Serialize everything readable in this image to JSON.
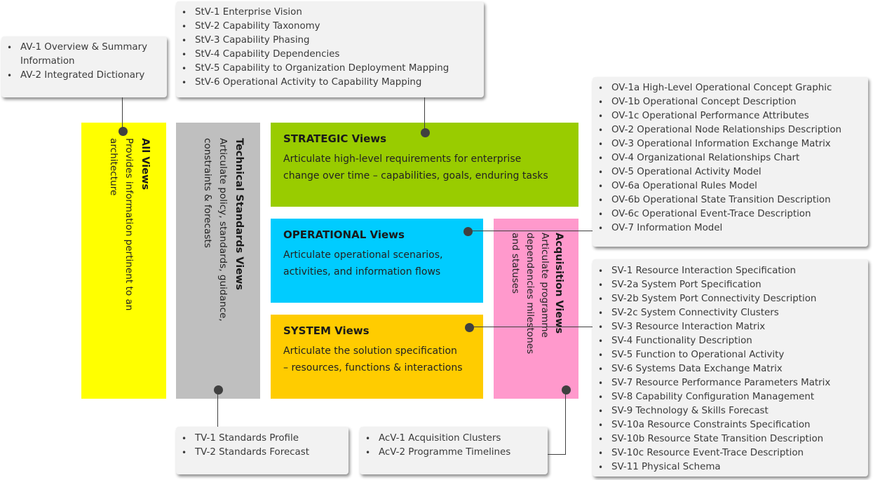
{
  "diagram": {
    "blocks": {
      "all_views": {
        "title": "All Views",
        "description": "Provides information pertinent to an architecture",
        "color": "#ffff00"
      },
      "technical_standards_views": {
        "title": "Technical Standards Views",
        "description": "Articulate policy, standards, guidance, constraints & forecasts",
        "color": "#bfbfbf"
      },
      "strategic_views": {
        "title": "STRATEGIC Views",
        "description_line1": "Articulate high-level requirements for enterprise",
        "description_line2": "change over time – capabilities, goals, enduring tasks",
        "color": "#99cc00"
      },
      "operational_views": {
        "title": "OPERATIONAL Views",
        "description_line1": "Articulate operational scenarios,",
        "description_line2": "activities, and information flows",
        "color": "#00ccff"
      },
      "system_views": {
        "title": "SYSTEM Views",
        "description_line1": "Articulate the solution specification",
        "description_line2": "– resources, functions & interactions",
        "color": "#ffcc00"
      },
      "acquisition_views": {
        "title": "Acquisition Views",
        "description": "Articulate programme dependencies milestones and statuses",
        "color": "#ff99cc"
      }
    },
    "callouts": {
      "av": [
        "AV-1 Overview & Summary Information",
        "AV-2 Integrated Dictionary"
      ],
      "stv": [
        "StV-1 Enterprise Vision",
        "StV-2 Capability Taxonomy",
        "StV-3 Capability Phasing",
        "StV-4 Capability Dependencies",
        "StV-5 Capability to Organization Deployment Mapping",
        "StV-6 Operational Activity to Capability Mapping"
      ],
      "ov": [
        "OV-1a High-Level Operational Concept Graphic",
        "OV-1b Operational Concept Description",
        "OV-1c Operational Performance Attributes",
        "OV-2 Operational Node Relationships Description",
        "OV-3 Operational Information Exchange Matrix",
        "OV-4 Organizational Relationships Chart",
        "OV-5 Operational Activity Model",
        "OV-6a Operational Rules Model",
        "OV-6b Operational State Transition Description",
        "OV-6c Operational Event-Trace Description",
        "OV-7 Information Model"
      ],
      "sv": [
        "SV-1 Resource Interaction Specification",
        "SV-2a System Port Specification",
        "SV-2b System Port Connectivity Description",
        "SV-2c System Connectivity Clusters",
        "SV-3 Resource Interaction Matrix",
        "SV-4 Functionality Description",
        "SV-5 Function to Operational Activity",
        "SV-6 Systems Data Exchange Matrix",
        "SV-7 Resource Performance Parameters Matrix",
        "SV-8 Capability Configuration Management",
        "SV-9 Technology & Skills Forecast",
        "SV-10a Resource Constraints Specification",
        "SV-10b Resource State Transition Description",
        "SV-10c Resource Event-Trace Description",
        "SV-11 Physical Schema"
      ],
      "tv": [
        "TV-1 Standards Profile",
        "TV-2 Standards Forecast"
      ],
      "acv": [
        "AcV-1 Acquisition Clusters",
        "AcV-2 Programme Timelines"
      ]
    },
    "connector_color": "#404040"
  }
}
